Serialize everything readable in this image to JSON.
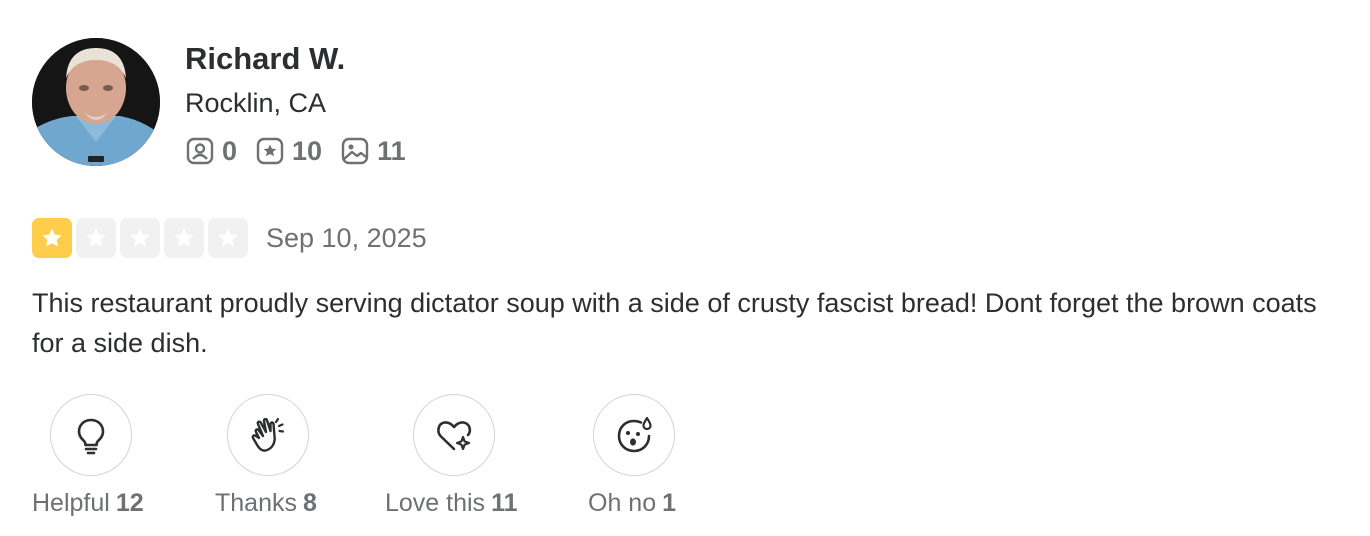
{
  "user": {
    "name": "Richard W.",
    "location": "Rocklin, CA",
    "avatar_icon": "user-avatar-photo",
    "stats": [
      {
        "icon": "friends-icon",
        "value": "0"
      },
      {
        "icon": "reviews-icon",
        "value": "10"
      },
      {
        "icon": "photos-icon",
        "value": "11"
      }
    ]
  },
  "review": {
    "rating": 1,
    "rating_max": 5,
    "date": "Sep 10, 2025",
    "text": "This restaurant proudly serving dictator soup with a side of crusty fascist bread! Dont forget the brown coats for a side dish."
  },
  "reactions": [
    {
      "icon": "lightbulb-icon",
      "label": "Helpful",
      "count": "12"
    },
    {
      "icon": "clapping-hands-icon",
      "label": "Thanks",
      "count": "8"
    },
    {
      "icon": "heart-sparkle-icon",
      "label": "Love this",
      "count": "11"
    },
    {
      "icon": "shocked-face-icon",
      "label": "Oh no",
      "count": "1"
    }
  ],
  "colors": {
    "star_filled": "#ffcc4b",
    "star_empty": "#f1f1f1",
    "text_primary": "#2d2e2f",
    "text_secondary": "#6e7072"
  }
}
